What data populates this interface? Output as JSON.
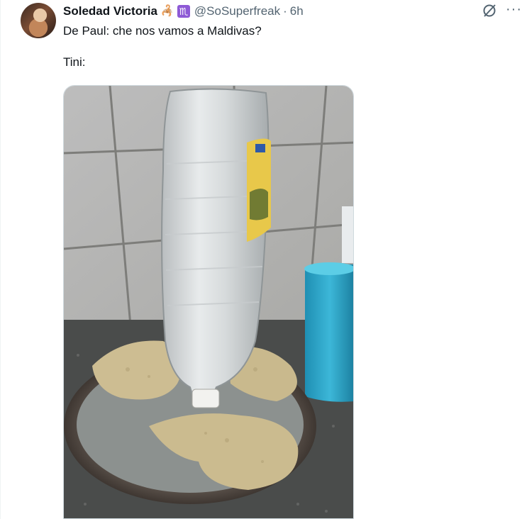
{
  "tweet": {
    "author_name": "Soledad Victoria",
    "badges": [
      "scorpion-emoji",
      "scorpio-zodiac-emoji"
    ],
    "badge_glyphs": [
      "🦂",
      "♏"
    ],
    "handle": "@SoSuperfreak",
    "separator": "·",
    "time": "6h",
    "text": "De Paul: che nos vamos a Maldivas?\n\nTini:",
    "more_glyph": "···"
  },
  "media": {
    "alt": "photo of an upside-down plastic bottle standing on breaded milanesas on a baking tray"
  },
  "colors": {
    "text": "#0f1419",
    "secondary": "#536471",
    "border": "#cfd9de"
  }
}
